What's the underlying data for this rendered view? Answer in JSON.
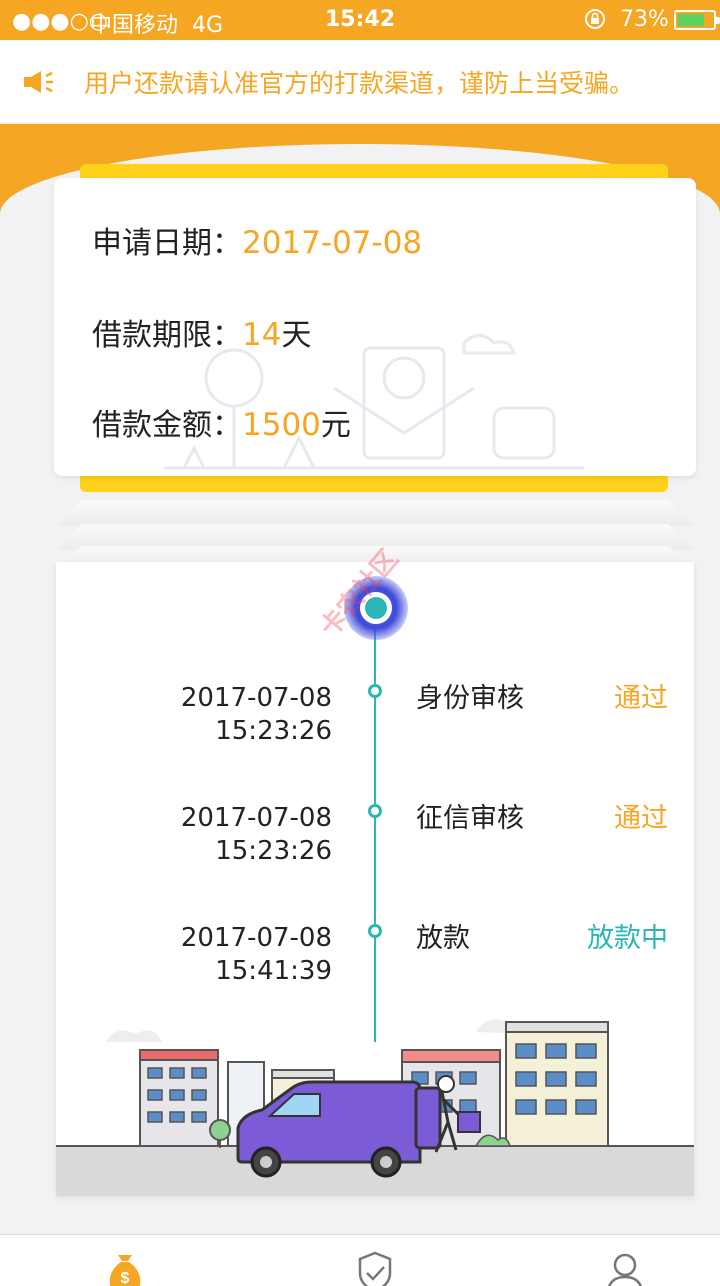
{
  "status_bar": {
    "signal": "●●●○○",
    "carrier": "中国移动",
    "network": "4G",
    "time": "15:42",
    "battery": "73%",
    "battery_level": 0.73
  },
  "notice": {
    "text": "用户还款请认准官方的打款渠道，谨防上当受骗。"
  },
  "loan_info": {
    "apply_date_label": "申请日期：",
    "apply_date": "2017-07-08",
    "term_label": "借款期限：",
    "term_value": "14",
    "term_unit": "天",
    "amount_label": "借款金额：",
    "amount_value": "1500",
    "amount_unit": "元"
  },
  "timeline": {
    "steps": [
      {
        "date": "2017-07-08",
        "time": "15:23:26",
        "name": "身份审核",
        "status": "通过",
        "status_color": "#f5a623"
      },
      {
        "date": "2017-07-08",
        "time": "15:23:26",
        "name": "征信审核",
        "status": "通过",
        "status_color": "#f5a623"
      },
      {
        "date": "2017-07-08",
        "time": "15:41:39",
        "name": "放款",
        "status": "放款中",
        "status_color": "#2cb5b5"
      }
    ]
  },
  "watermark": "卡农社区",
  "colors": {
    "accent_orange": "#f5a623",
    "accent_yellow": "#ffd11a",
    "teal": "#2cb5b5",
    "van_purple": "#7b5bd6"
  },
  "tabbar": {
    "items": [
      {
        "icon": "money-bag-icon",
        "active": true
      },
      {
        "icon": "shield-check-icon",
        "active": false
      },
      {
        "icon": "user-icon",
        "active": false
      }
    ]
  }
}
